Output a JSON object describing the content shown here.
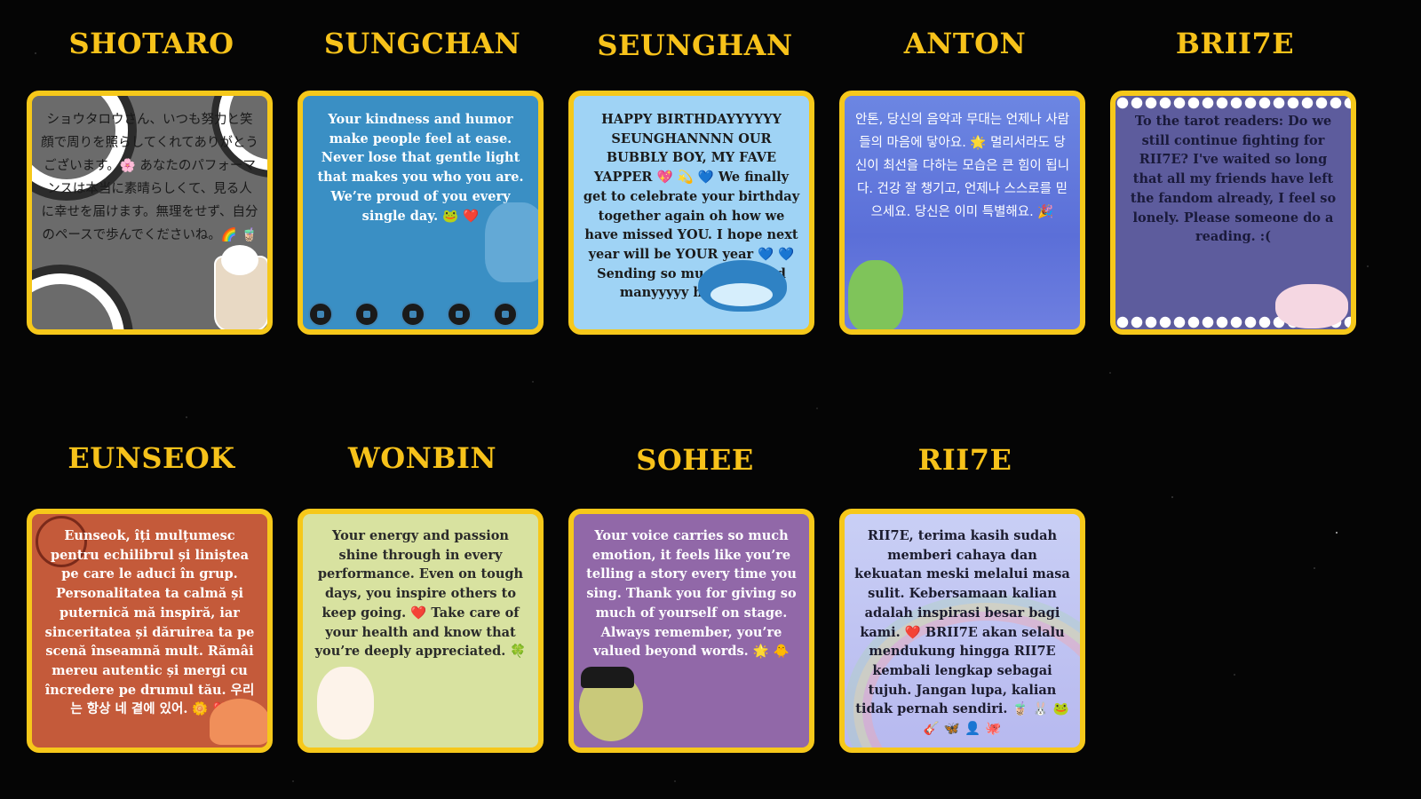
{
  "names": {
    "shotaro": "SHOTARO",
    "sungchan": "SUNGCHAN",
    "seunghan": "SEUNGHAN",
    "anton": "ANTON",
    "brii7e": "BRII7E",
    "eunseok": "EUNSEOK",
    "wonbin": "WONBIN",
    "sohee": "SOHEE",
    "rii7e": "RII7E"
  },
  "messages": {
    "shotaro": "ショウタロウさん、いつも努力と笑顔で周りを照らしてくれてありがとうございます。🌸 あなたのパフォーマンスは本当に素晴らしくて、見る人に幸せを届けます。無理をせず、自分のペースで歩んでくださいね。🌈 🧋",
    "sungchan": "Your kindness and humor make people feel at ease. Never lose that gentle light that makes you who you are. We’re proud of you every single day. 🐸 ❤️",
    "seunghan": "HAPPY BIRTHDAYYYYYY SEUNGHANNNN OUR BUBBLY BOY, MY FAVE YAPPER 💖 💫 💙 We finally get to celebrate your birthday together again oh how we have missed YOU. I hope next year will be YOUR year 💙 💙 Sending so much love and manyyyyy hugsss 🔮",
    "anton": "안톤, 당신의 음악과 무대는 언제나 사람들의 마음에 닿아요. 🌟 멀리서라도 당신이 최선을 다하는 모습은 큰 힘이 됩니다. 건강 잘 챙기고, 언제나 스스로를 믿으세요. 당신은 이미 특별해요. 🎉",
    "brii7e": "To the tarot readers: Do we still continue fighting for RII7E? I've waited so long that all my friends have left the fandom already, I feel so lonely. Please someone do a reading. :(",
    "eunseok": "Eunseok, îți mulțumesc pentru echilibrul și liniștea pe care le aduci în grup. Personalitatea ta calmă și puternică mă inspiră, iar sinceritatea și dăruirea ta pe scenă înseamnă mult. Rămâi mereu autentic și mergi cu încredere pe drumul tău. 우리는 항상 네 곁에 있어. 🌼 ❤️",
    "wonbin": "Your energy and passion shine through in every performance. Even on tough days, you inspire others to keep going. ❤️ Take care of your health and know that you’re deeply appreciated. 🍀",
    "sohee": "Your voice carries so much emotion, it feels like you’re telling a story every time you sing. Thank you for giving so much of yourself on stage. Always remember, you’re valued beyond words. 🌟 🐥",
    "rii7e": "RII7E, terima kasih sudah memberi cahaya dan kekuatan meski melalui masa sulit. Kebersamaan kalian adalah inspirasi besar bagi kami. ❤️ BRII7E akan selalu mendukung hingga RII7E kembali lengkap sebagai tujuh. Jangan lupa, kalian tidak pernah sendiri. 🧋 🐰 🐸 🎸 🦋 👤 🐙"
  },
  "colors": {
    "title": "#f7c21a",
    "border": "#f6c81a",
    "background": "#050505"
  }
}
